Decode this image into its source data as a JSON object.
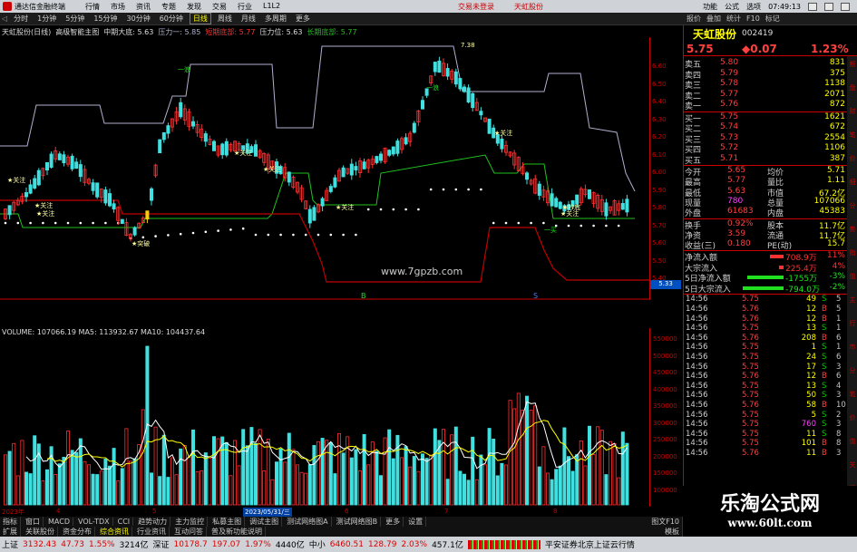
{
  "app": {
    "title": "通达信金融终端",
    "menu": [
      "行情",
      "市场",
      "资讯",
      "专题",
      "发现",
      "交易",
      "行业",
      "L1L2"
    ],
    "mid_links": [
      "交易未登录",
      "天虹股份"
    ],
    "right_menu": [
      "功能",
      "公式",
      "选项"
    ],
    "clock": "07:49:13"
  },
  "period_bar": {
    "items": [
      "分时",
      "1分钟",
      "5分钟",
      "15分钟",
      "30分钟",
      "60分钟",
      "日线",
      "周线",
      "月线",
      "多周期",
      "更多"
    ],
    "active": "日线"
  },
  "right_toolbar": [
    "报价",
    "叠加",
    "统计",
    "F10",
    "标记"
  ],
  "chart_info": {
    "stock": "天虹股份(日线)",
    "indicator": "高级智能主图",
    "mid_label": "中期大底: 5.63",
    "pressure1": "压力一: 5.85",
    "short_label": "短期底部: 5.77",
    "pressure": "压力位: 5.63",
    "long_label": "长期底部: 5.77"
  },
  "price_axis": [
    "6.60",
    "6.50",
    "6.40",
    "6.30",
    "6.20",
    "6.10",
    "6.00",
    "5.90",
    "5.80",
    "5.70",
    "5.60",
    "5.50",
    "5.40"
  ],
  "last_price_tag": "5.33",
  "watermark_mid": "www.7gpzb.com",
  "annotations": [
    "一浪",
    "一浪",
    "7.38",
    "★关注",
    "★关注",
    "★关注",
    "★关注",
    "★关注",
    "★关注",
    "★关注",
    "★关注",
    "★抄底",
    "★突破",
    "一买"
  ],
  "mark_labels": [
    "B",
    "S"
  ],
  "volume": {
    "info": "VOLUME: 107066.19  MA5: 113932.67  MA10: 104437.64",
    "axis": [
      "550000",
      "500000",
      "450000",
      "400000",
      "350000",
      "300000",
      "250000",
      "200000",
      "150000",
      "100000"
    ]
  },
  "date_row": [
    "2023年",
    "4",
    "5",
    "2023/05/31/三",
    "6",
    "7",
    "8"
  ],
  "tabs_main": [
    "指标",
    "窗口",
    "MACD",
    "VOL-TDX",
    "CCI",
    "趋势动力",
    "主力监控",
    "私募主图",
    "调试主图",
    "测试网络图A",
    "测试网络图B",
    "更多",
    "设置"
  ],
  "tabs_sub": [
    "扩展",
    "关联股份",
    "资金分布",
    "综合资讯",
    "行业资讯",
    "互动问答",
    "普及新功能说明"
  ],
  "tabs_sub_active": "综合资讯",
  "tabs_end": [
    "模板",
    "图文F10"
  ],
  "status": {
    "items": [
      {
        "name": "上证",
        "val": "3132.43",
        "chg": "47.73",
        "pct": "1.55%",
        "amt": "3214亿"
      },
      {
        "name": "深证",
        "val": "10178.7",
        "chg": "197.07",
        "pct": "1.97%",
        "amt": "4440亿"
      },
      {
        "name": "中小",
        "val": "6460.51",
        "chg": "128.79",
        "pct": "2.03%",
        "amt": "457.1亿"
      }
    ],
    "right": "平安证券北京上证云行情"
  },
  "quote": {
    "name": "天虹股份",
    "code": "002419",
    "price": "5.75",
    "change": "◆0.07",
    "pct": "1.23%"
  },
  "orderbook": {
    "asks": [
      {
        "label": "卖五",
        "price": "5.80",
        "vol": "831"
      },
      {
        "label": "卖四",
        "price": "5.79",
        "vol": "375"
      },
      {
        "label": "卖三",
        "price": "5.78",
        "vol": "1138"
      },
      {
        "label": "卖二",
        "price": "5.77",
        "vol": "2071"
      },
      {
        "label": "卖一",
        "price": "5.76",
        "vol": "872"
      }
    ],
    "bids": [
      {
        "label": "买一",
        "price": "5.75",
        "vol": "1621"
      },
      {
        "label": "买二",
        "price": "5.74",
        "vol": "672"
      },
      {
        "label": "买三",
        "price": "5.73",
        "vol": "2554"
      },
      {
        "label": "买四",
        "price": "5.72",
        "vol": "1106"
      },
      {
        "label": "买五",
        "price": "5.71",
        "vol": "387"
      }
    ]
  },
  "stats": [
    {
      "l1": "今开",
      "v1": "5.65",
      "l2": "均价",
      "v2": "5.71"
    },
    {
      "l1": "最高",
      "v1": "5.77",
      "l2": "量比",
      "v2": "1.11"
    },
    {
      "l1": "最低",
      "v1": "5.63",
      "l2": "市值",
      "v2": "67.2亿"
    },
    {
      "l1": "现量",
      "v1": "780",
      "l2": "总量",
      "v2": "107066"
    },
    {
      "l1": "外盘",
      "v1": "61683",
      "l2": "内盘",
      "v2": "45383"
    },
    {
      "l1": "换手",
      "v1": "0.92%",
      "l2": "股本",
      "v2": "11.7亿"
    },
    {
      "l1": "净资",
      "v1": "3.59",
      "l2": "流通",
      "v2": "11.7亿"
    },
    {
      "l1": "收益(三)",
      "v1": "0.180",
      "l2": "PE(动)",
      "v2": "15.7"
    }
  ],
  "flows": [
    {
      "label": "净流入额",
      "val": "708.9万",
      "pct": "11%",
      "color": "#ff3030",
      "len": 0.3
    },
    {
      "label": "大宗流入",
      "val": "225.4万",
      "pct": "4%",
      "color": "#ff3030",
      "len": 0.1
    },
    {
      "label": "5日净流入额",
      "val": "-1755万",
      "pct": "-3%",
      "color": "#20e020",
      "len": 0.8
    },
    {
      "label": "5日大宗流入",
      "val": "-794.0万",
      "pct": "-2%",
      "color": "#20e020",
      "len": 0.9
    }
  ],
  "ticks": [
    {
      "t": "14:56",
      "p": "5.75",
      "v": "49",
      "s": "S",
      "n": "5"
    },
    {
      "t": "14:56",
      "p": "5.76",
      "v": "12",
      "s": "B",
      "n": "5"
    },
    {
      "t": "14:56",
      "p": "5.76",
      "v": "12",
      "s": "B",
      "n": "1"
    },
    {
      "t": "14:56",
      "p": "5.75",
      "v": "13",
      "s": "S",
      "n": "1"
    },
    {
      "t": "14:56",
      "p": "5.76",
      "v": "208",
      "s": "B",
      "n": "6"
    },
    {
      "t": "14:56",
      "p": "5.75",
      "v": "1",
      "s": "S",
      "n": "1"
    },
    {
      "t": "14:56",
      "p": "5.75",
      "v": "24",
      "s": "S",
      "n": "6"
    },
    {
      "t": "14:56",
      "p": "5.75",
      "v": "17",
      "s": "S",
      "n": "3"
    },
    {
      "t": "14:56",
      "p": "5.76",
      "v": "12",
      "s": "B",
      "n": "6"
    },
    {
      "t": "14:56",
      "p": "5.75",
      "v": "13",
      "s": "S",
      "n": "4"
    },
    {
      "t": "14:56",
      "p": "5.75",
      "v": "50",
      "s": "S",
      "n": "3"
    },
    {
      "t": "14:56",
      "p": "5.76",
      "v": "58",
      "s": "B",
      "n": "10"
    },
    {
      "t": "14:56",
      "p": "5.75",
      "v": "5",
      "s": "S",
      "n": "2"
    },
    {
      "t": "14:56",
      "p": "5.75",
      "v": "760",
      "s": "S",
      "n": "3"
    },
    {
      "t": "14:56",
      "p": "5.75",
      "v": "11",
      "s": "S",
      "n": "8"
    },
    {
      "t": "14:56",
      "p": "5.75",
      "v": "101",
      "s": "B",
      "n": "8"
    },
    {
      "t": "14:56",
      "p": "5.76",
      "v": "11",
      "s": "B",
      "n": "3"
    }
  ],
  "scroll_items": [
    "额",
    "盘",
    "财",
    "笔",
    "价",
    "细",
    "分",
    "势",
    "指",
    "值",
    "主",
    "行",
    "市",
    "分",
    "笔",
    "价",
    "值",
    "关",
    "键"
  ],
  "brand_watermark": {
    "title": "乐淘公式网",
    "url": "www.60lt.com"
  },
  "colors": {
    "up": "#ff3030",
    "down": "#40e0e0",
    "ma_white": "#ffffff",
    "ma_yellow": "#ffff00",
    "resist": "#b0b0d0",
    "support_green": "#20c020",
    "bottom_red": "#c00000"
  }
}
